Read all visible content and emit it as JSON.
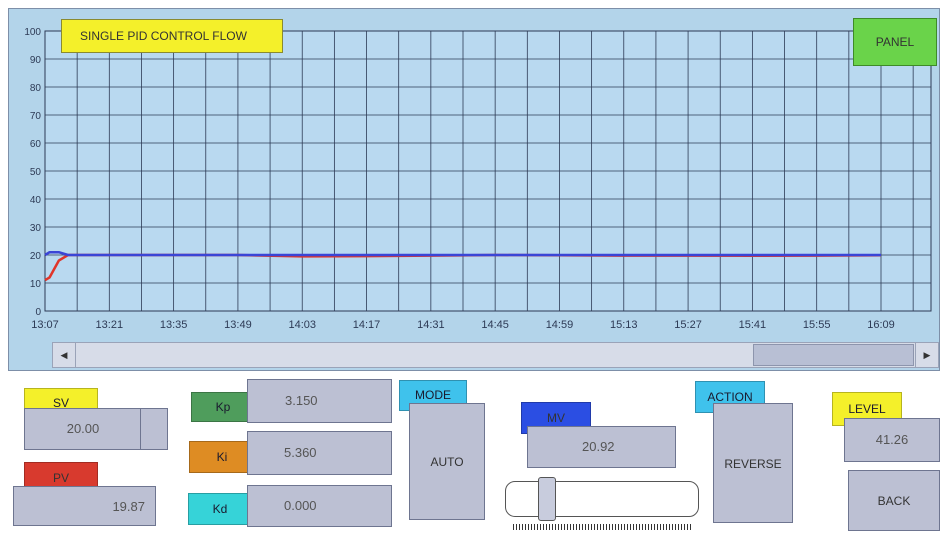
{
  "colors": {
    "setpoint_line": "#e0352a",
    "process_line": "#3a45d6",
    "sv_tag": "#f4f02a",
    "pv_tag": "#d83a2e",
    "kp_tag": "#4f9d5c",
    "ki_tag": "#de8c23",
    "kd_tag": "#36d3d8",
    "mode_tag": "#3fc2ec",
    "mv_tag": "#2b4ee3",
    "action_tag": "#3fc2ec",
    "level_tag": "#f4f02a",
    "panel_button": "#6ad34a"
  },
  "trend": {
    "title": "SINGLE PID CONTROL FLOW",
    "panel_button": "PANEL",
    "y_ticks": [
      "0",
      "10",
      "20",
      "30",
      "40",
      "50",
      "60",
      "70",
      "80",
      "90",
      "100"
    ],
    "x_ticks": [
      "13:07",
      "13:21",
      "13:35",
      "13:49",
      "14:03",
      "14:17",
      "14:31",
      "14:45",
      "14:59",
      "15:13",
      "15:27",
      "15:41",
      "15:55",
      "16:09"
    ],
    "scroll_left_icon": "arrow-left-icon",
    "scroll_right_icon": "arrow-right-icon"
  },
  "chart_data": {
    "type": "line",
    "title": "SINGLE PID CONTROL FLOW",
    "ylim": [
      0,
      100
    ],
    "x_label_ticks": [
      "13:07",
      "13:21",
      "13:35",
      "13:49",
      "14:03",
      "14:17",
      "14:31",
      "14:45",
      "14:59",
      "15:13",
      "15:27",
      "15:41",
      "15:55",
      "16:09"
    ],
    "series": [
      {
        "color": "#e0352a",
        "x": [
          "13:07",
          "13:08",
          "13:10",
          "13:12",
          "13:21",
          "13:35",
          "13:49",
          "14:03",
          "14:17",
          "14:31",
          "14:45",
          "14:59",
          "15:13",
          "15:27",
          "15:41",
          "15:55",
          "16:09"
        ],
        "values": [
          11,
          12,
          18,
          20,
          20,
          20,
          20,
          19.5,
          19.6,
          19.8,
          20,
          19.9,
          19.8,
          19.8,
          19.7,
          19.8,
          19.9
        ]
      },
      {
        "color": "#3a45d6",
        "x": [
          "13:07",
          "13:08",
          "13:10",
          "13:12",
          "13:21",
          "13:35",
          "13:49",
          "14:03",
          "14:17",
          "14:31",
          "14:45",
          "14:59",
          "15:13",
          "15:27",
          "15:41",
          "15:55",
          "16:09"
        ],
        "values": [
          20,
          21,
          21,
          20,
          20,
          20,
          20,
          20,
          20,
          20,
          20,
          20,
          20,
          20,
          20,
          20,
          20
        ]
      }
    ]
  },
  "controls": {
    "sv_label": "SV",
    "sv_value": "20.00",
    "pv_label": "PV",
    "pv_value": "19.87",
    "kp_label": "Kp",
    "kp_value": "3.150",
    "ki_label": "Ki",
    "ki_value": "5.360",
    "kd_label": "Kd",
    "kd_value": "0.000",
    "mode_label": "MODE",
    "mode_value": "AUTO",
    "mv_label": "MV",
    "mv_value": "20.92",
    "action_label": "ACTION",
    "action_value": "REVERSE",
    "level_label": "LEVEL",
    "level_value": "41.26",
    "back_button": "BACK"
  }
}
